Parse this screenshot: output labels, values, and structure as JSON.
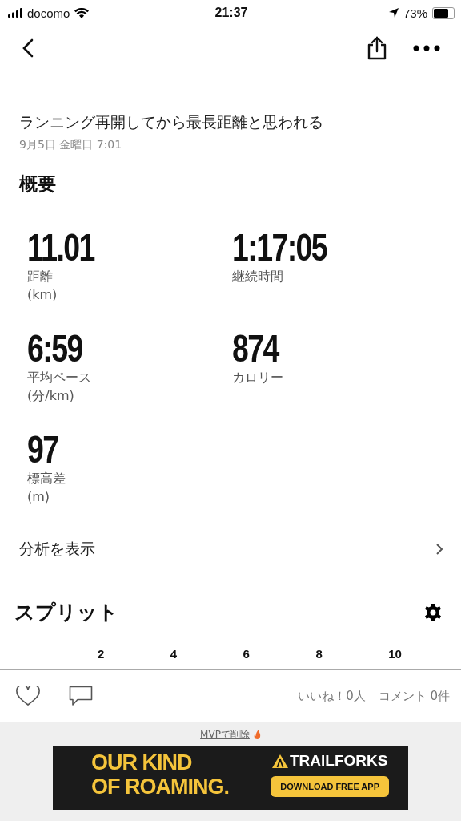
{
  "status_bar": {
    "carrier": "docomo",
    "time": "21:37",
    "battery": "73%"
  },
  "activity": {
    "title": "ランニング再開してから最長距離と思われる",
    "date": "9月5日 金曜日 7:01"
  },
  "overview": {
    "heading": "概要",
    "stats": [
      {
        "value": "11.01",
        "label": "距離",
        "unit": "(km)"
      },
      {
        "value": "1:17:05",
        "label": "継続時間"
      },
      {
        "value": "6:59",
        "label": "平均ペース",
        "unit": "(分/km)"
      },
      {
        "value": "874",
        "label": "カロリー"
      },
      {
        "value": "97",
        "label": "標高差",
        "unit": "(m)"
      }
    ]
  },
  "analysis_link": "分析を表示",
  "splits": {
    "heading": "スプリット",
    "axis_ticks": [
      "2",
      "4",
      "6",
      "8",
      "10"
    ]
  },
  "social": {
    "likes": "いいね！0人",
    "comments": "コメント 0件"
  },
  "ad": {
    "remove_link": "MVPで削除",
    "headline": [
      "OUR KIND",
      "OF ROAMING."
    ],
    "brand": "TRAILFORKS",
    "cta": "DOWNLOAD FREE APP"
  }
}
